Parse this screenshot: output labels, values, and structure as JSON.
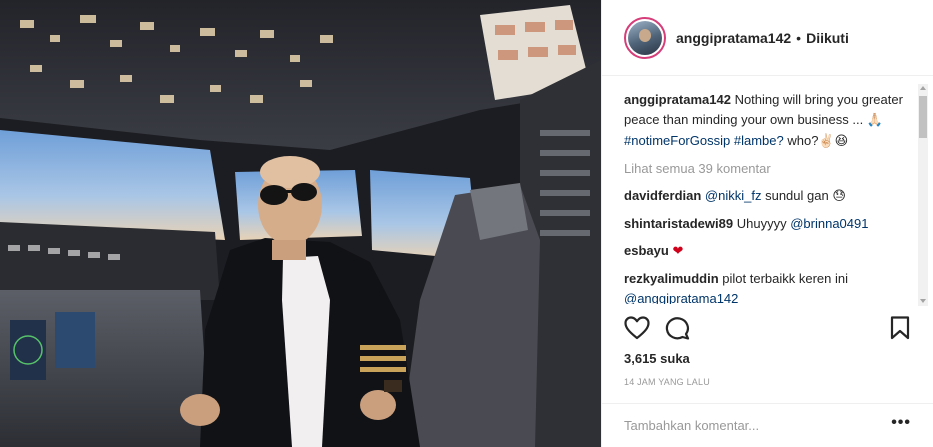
{
  "post": {
    "author": "anggipratama142",
    "separator": "•",
    "follow_status": "Diikuti",
    "caption": {
      "author": "anggipratama142",
      "text_1": "Nothing will bring you greater peace than minding your own business ...",
      "emoji_1": "🙏🏻",
      "hashtag_1": "#notimeForGossip",
      "hashtag_2": "#lambe?",
      "text_2": "who?",
      "emoji_2": "✌🏻😆"
    },
    "view_all_comments": "Lihat semua 39 komentar",
    "comments": [
      {
        "user": "davidferdian",
        "mention": "@nikki_fz",
        "text": "sundul gan",
        "emoji": "😓"
      },
      {
        "user": "shintaristadewi89",
        "text": "Uhuyyyy",
        "mention": "@brinna0491"
      },
      {
        "user": "esbayu",
        "emoji": "❤"
      },
      {
        "user": "rezkyalimuddin",
        "text": "pilot terbaikk keren ini",
        "mention": "@anggipratama142"
      }
    ],
    "likes": "3,615 suka",
    "timestamp": "14 JAM YANG LALU",
    "add_comment_placeholder": "Tambahkan komentar...",
    "more_label": "•••"
  },
  "icons": [
    "heart-icon",
    "comment-icon",
    "bookmark-icon"
  ],
  "colors": {
    "link": "#003569",
    "muted": "#999999",
    "text": "#262626",
    "heart": "#d0021b",
    "avatar_ring": "#d63e7a"
  }
}
